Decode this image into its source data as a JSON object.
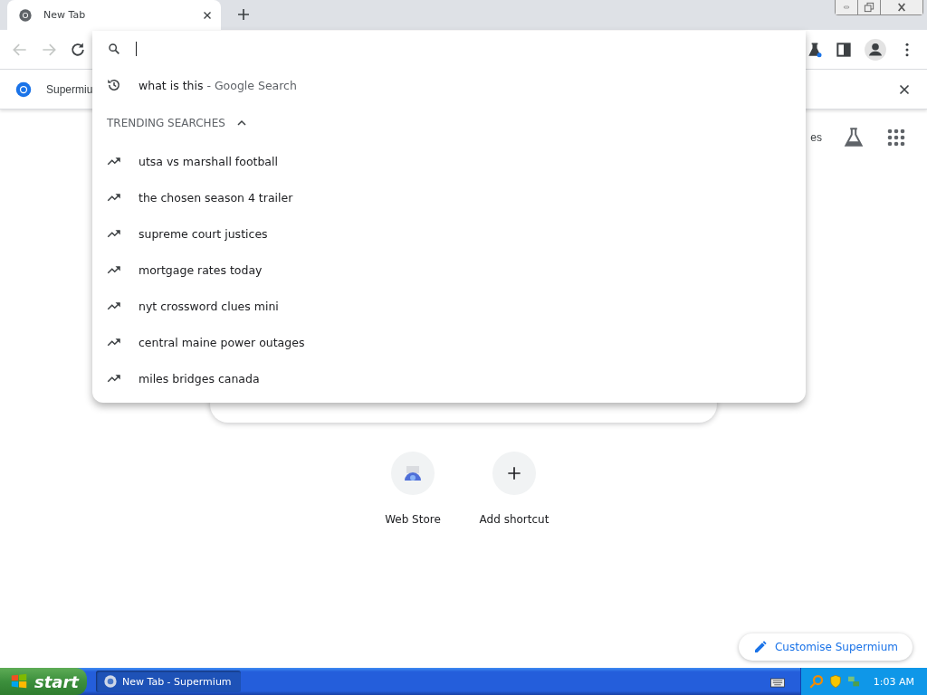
{
  "window": {
    "controls": [
      {
        "kind": "minimize"
      },
      {
        "kind": "restore"
      },
      {
        "kind": "close"
      }
    ]
  },
  "tabs": [
    {
      "title": "New Tab",
      "selected": true
    }
  ],
  "info_bar": {
    "text": "Supermiu"
  },
  "dropdown": {
    "history": [
      {
        "query": "what is this",
        "suffix": " - Google Search"
      }
    ],
    "trending": {
      "title": "TRENDING SEARCHES",
      "expanded": true,
      "items": [
        "utsa vs marshall football",
        "the chosen season 4 trailer",
        "supreme court justices",
        "mortgage rates today",
        "nyt crossword clues mini",
        "central maine power outages",
        "miles bridges canada"
      ]
    }
  },
  "page": {
    "header_link": "es",
    "shortcuts": [
      {
        "label": "Web Store",
        "kind": "store"
      },
      {
        "label": "Add shortcut",
        "kind": "add"
      }
    ],
    "customise": "Customise Supermium"
  },
  "taskbar": {
    "start": "start",
    "tasks": [
      {
        "label": "New Tab - Supermium",
        "selected": true
      }
    ],
    "clock": "1:03 AM"
  }
}
